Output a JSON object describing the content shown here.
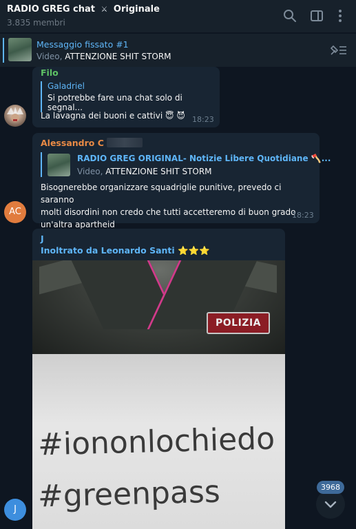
{
  "header": {
    "title": "RADIO GREG chat",
    "title_icon": "crossed-swords-emoji",
    "title_suffix": "Originale",
    "members": "3.835 membri",
    "icons": [
      "search-icon",
      "sidebar-toggle-icon",
      "more-vertical-icon"
    ]
  },
  "pinned": {
    "title": "Messaggio fissato #1",
    "type_label": "Video,",
    "text": "ATTENZIONE SHIT STORM",
    "icon": "unpin-list-icon"
  },
  "messages": [
    {
      "sender": "Filo",
      "sender_color": "#5ec265",
      "reply_name": "Galadriel",
      "reply_text": "Si potrebbe fare una chat solo di segnal...",
      "text": "La lavagna dei buoni e cattivi 😇 😈",
      "time": "18:23"
    },
    {
      "sender": "Alessandro C",
      "sender_color": "#e98a45",
      "avatar_initials": "AC",
      "reply_name": "RADIO GREG ORIGINAL- Notizie Libere Quotidiane 🪓...",
      "reply_type": "Video,",
      "reply_text": "ATTENZIONE SHIT STORM",
      "lines": [
        "Bisognerebbe organizzare squadriglie punitive, prevedo ci saranno",
        "molti disordini non credo che tutti accetteremo di buon grado",
        "un'altra apartheid"
      ],
      "time": "18:23"
    },
    {
      "sender": "J",
      "sender_color": "#5eb5f7",
      "avatar_initials": "J",
      "forwarded": "Inoltrato da Leonardo Santi ⭐⭐⭐",
      "photo": {
        "badge": "POLIZIA",
        "line1": "#iononlochiedo",
        "line2": "#greenpass"
      }
    }
  ],
  "scroll": {
    "unread_count": "3968",
    "icon": "chevron-down-icon"
  },
  "colors": {
    "background": "#0e1621",
    "bubble": "#182533",
    "accent": "#5eb5f7"
  }
}
